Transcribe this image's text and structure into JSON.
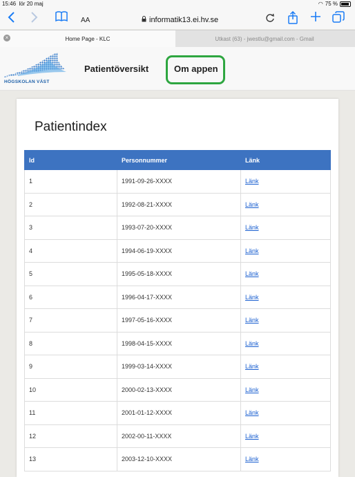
{
  "status": {
    "time": "15:46",
    "date": "lör 20 maj",
    "battery": "75 %"
  },
  "toolbar": {
    "text_size": "AA",
    "url": "informatik13.ei.hv.se"
  },
  "tabs": [
    {
      "label": "Home Page - KLC"
    },
    {
      "label": "Utkast (63) - jwestlu@gmail.com - Gmail"
    }
  ],
  "nav": {
    "logo_text": "HÖGSKOLAN VÄST",
    "links": [
      {
        "label": "Patientöversikt"
      },
      {
        "label": "Om appen"
      }
    ]
  },
  "page": {
    "title": "Patientindex"
  },
  "table": {
    "headers": [
      "Id",
      "Personnummer",
      "Länk"
    ],
    "rows": [
      {
        "id": "1",
        "pnr": "1991-09-26-XXXX",
        "link": "Länk"
      },
      {
        "id": "2",
        "pnr": "1992-08-21-XXXX",
        "link": "Länk"
      },
      {
        "id": "3",
        "pnr": "1993-07-20-XXXX",
        "link": "Länk"
      },
      {
        "id": "4",
        "pnr": "1994-06-19-XXXX",
        "link": "Länk"
      },
      {
        "id": "5",
        "pnr": "1995-05-18-XXXX",
        "link": "Länk"
      },
      {
        "id": "6",
        "pnr": "1996-04-17-XXXX",
        "link": "Länk"
      },
      {
        "id": "7",
        "pnr": "1997-05-16-XXXX",
        "link": "Länk"
      },
      {
        "id": "8",
        "pnr": "1998-04-15-XXXX",
        "link": "Länk"
      },
      {
        "id": "9",
        "pnr": "1999-03-14-XXXX",
        "link": "Länk"
      },
      {
        "id": "10",
        "pnr": "2000-02-13-XXXX",
        "link": "Länk"
      },
      {
        "id": "11",
        "pnr": "2001-01-12-XXXX",
        "link": "Länk"
      },
      {
        "id": "12",
        "pnr": "2002-00-11-XXXX",
        "link": "Länk"
      },
      {
        "id": "13",
        "pnr": "2003-12-10-XXXX",
        "link": "Länk"
      }
    ]
  },
  "colors": {
    "accent": "#1a7cf5",
    "table_header": "#3d73c1",
    "highlight": "#2ea640"
  }
}
